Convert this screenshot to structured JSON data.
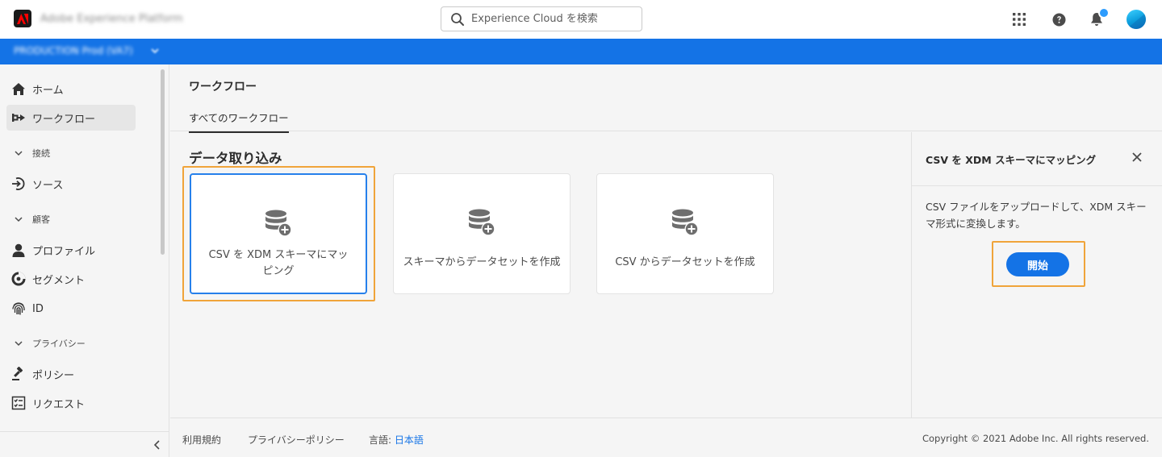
{
  "header": {
    "app_name": "Adobe Experience Platform",
    "search_placeholder": "Experience Cloud を検索"
  },
  "org": {
    "selector_text": "PRODUCTION  Prod (VA7)"
  },
  "sidebar": {
    "items": [
      {
        "label": "ホーム",
        "icon": "home-icon"
      },
      {
        "label": "ワークフロー",
        "icon": "workflow-icon",
        "active": true
      },
      {
        "label": "接続",
        "type": "group"
      },
      {
        "label": "ソース",
        "icon": "sources-icon"
      },
      {
        "label": "顧客",
        "type": "group"
      },
      {
        "label": "プロファイル",
        "icon": "profile-icon"
      },
      {
        "label": "セグメント",
        "icon": "segment-icon"
      },
      {
        "label": "ID",
        "icon": "fingerprint-icon"
      },
      {
        "label": "プライバシー",
        "type": "group"
      },
      {
        "label": "ポリシー",
        "icon": "gavel-icon"
      },
      {
        "label": "リクエスト",
        "icon": "checklist-icon"
      }
    ]
  },
  "main": {
    "title": "ワークフロー",
    "tab": "すべてのワークフロー",
    "section_title": "データ取り込み",
    "cards": [
      {
        "label": "CSV を XDM スキーマにマッピング"
      },
      {
        "label": "スキーマからデータセットを作成"
      },
      {
        "label": "CSV からデータセットを作成"
      }
    ]
  },
  "panel": {
    "title": "CSV を XDM スキーマにマッピング",
    "description": "CSV ファイルをアップロードして、XDM スキーマ形式に変換します。",
    "start_label": "開始"
  },
  "footer": {
    "terms": "利用規約",
    "privacy": "プライバシーポリシー",
    "language_label": "言語:",
    "language_value": "日本語",
    "copyright": "Copyright © 2021 Adobe Inc.  All rights reserved."
  },
  "colors": {
    "accent_blue": "#1473e6",
    "highlight_orange": "#f0a43a",
    "selected_border": "#2680eb"
  }
}
